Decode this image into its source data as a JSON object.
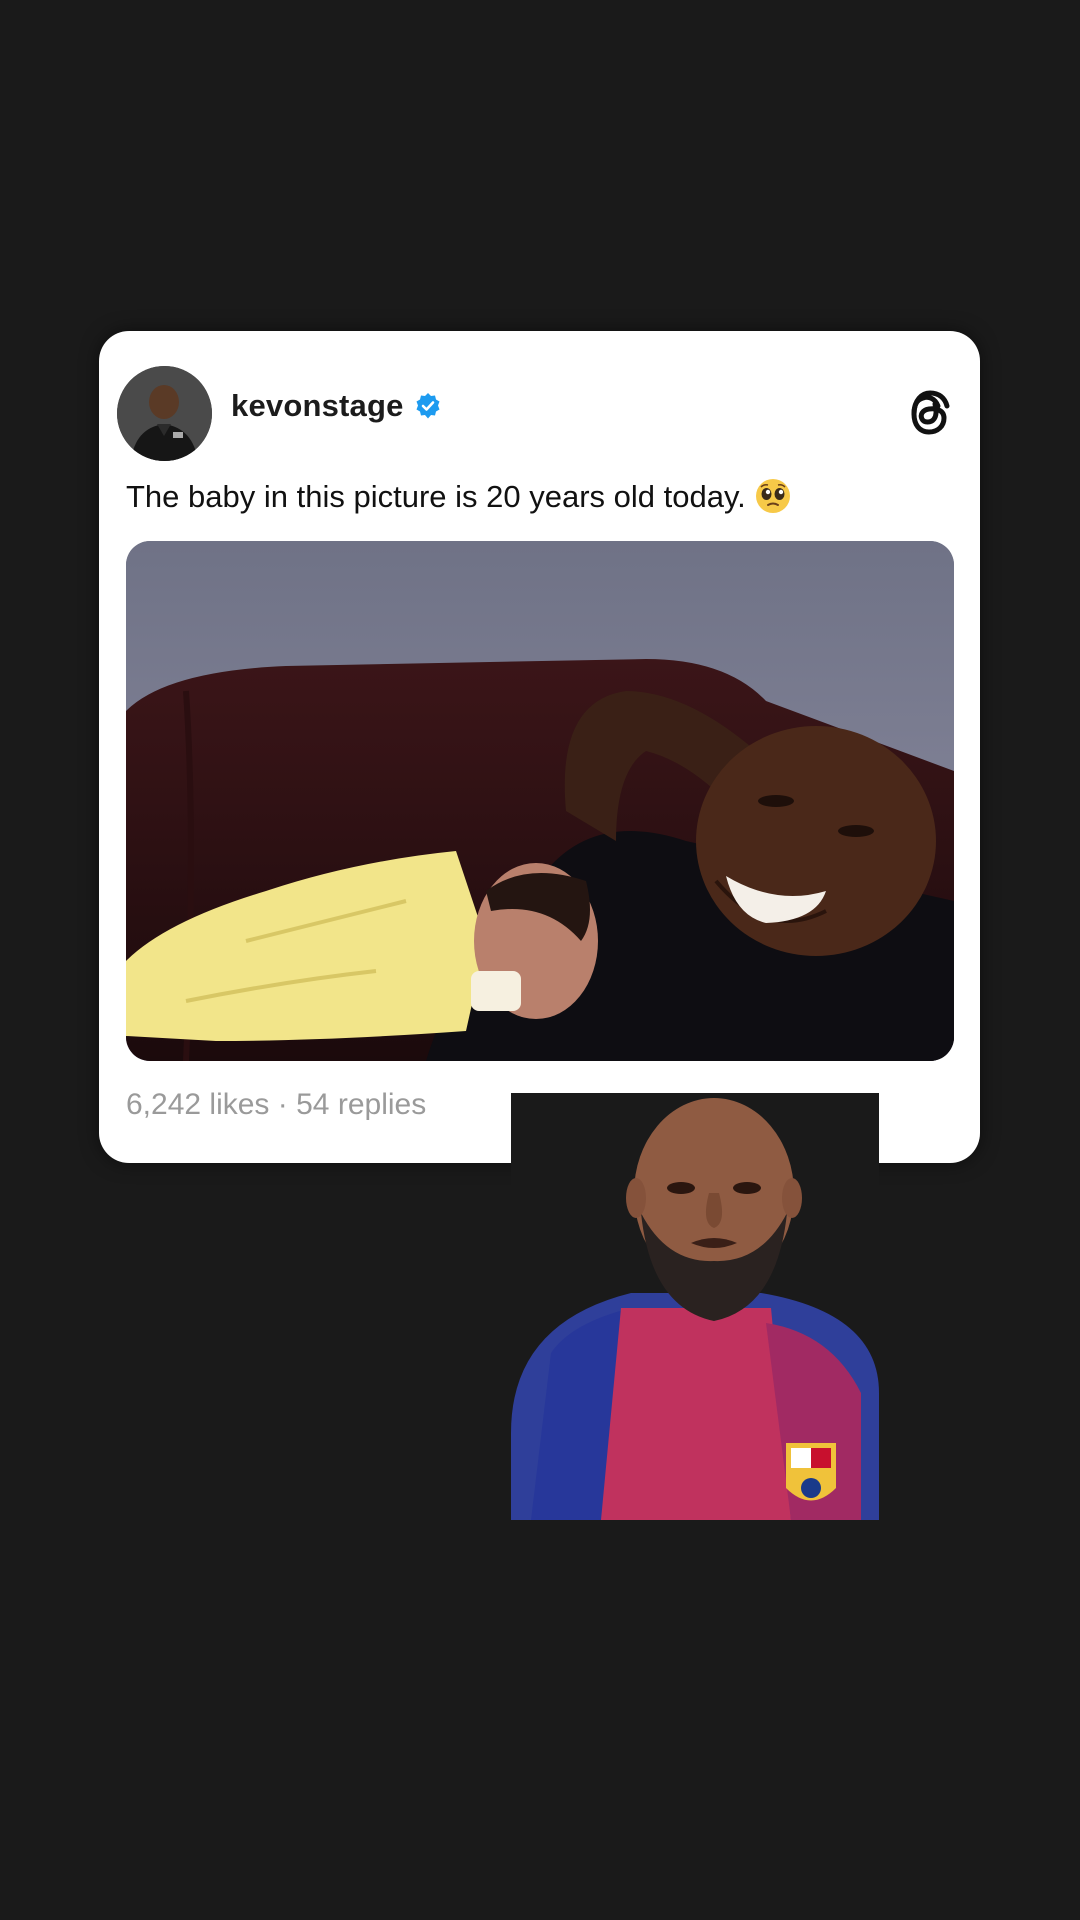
{
  "post": {
    "username": "kevonstage",
    "verified_icon": "verified-badge-icon",
    "app_icon": "threads-logo-icon",
    "text": "The baby in this picture is 20 years old today.",
    "emoji": "pleading-face-emoji",
    "likes": "6,242 likes",
    "separator": "·",
    "replies": "54 replies",
    "colors": {
      "verified_blue": "#1d9bf0",
      "stats_gray": "#9a9a9a",
      "card_bg": "#ffffff",
      "page_bg": "#1a1a1a"
    }
  },
  "overlay": {
    "description_icon": "creator-camera-video"
  }
}
